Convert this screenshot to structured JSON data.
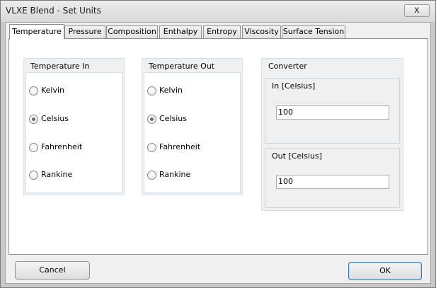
{
  "window": {
    "title": "VLXE Blend - Set Units",
    "close_glyph": "x"
  },
  "tabs": [
    {
      "label": "Temperature",
      "active": true
    },
    {
      "label": "Pressure"
    },
    {
      "label": "Composition"
    },
    {
      "label": "Enthalpy"
    },
    {
      "label": "Entropy"
    },
    {
      "label": "Viscosity"
    },
    {
      "label": "Surface Tension"
    }
  ],
  "temperature_in": {
    "title": "Temperature In",
    "options": [
      "Kelvin",
      "Celsius",
      "Fahrenheit",
      "Rankine"
    ],
    "selected": "Celsius"
  },
  "temperature_out": {
    "title": "Temperature Out",
    "options": [
      "Kelvin",
      "Celsius",
      "Fahrenheit",
      "Rankine"
    ],
    "selected": "Celsius"
  },
  "converter": {
    "title": "Converter",
    "in_title": "In [Celsius]",
    "in_value": "100",
    "out_title": "Out [Celsius]",
    "out_value": "100"
  },
  "buttons": {
    "cancel": "Cancel",
    "ok": "OK"
  }
}
